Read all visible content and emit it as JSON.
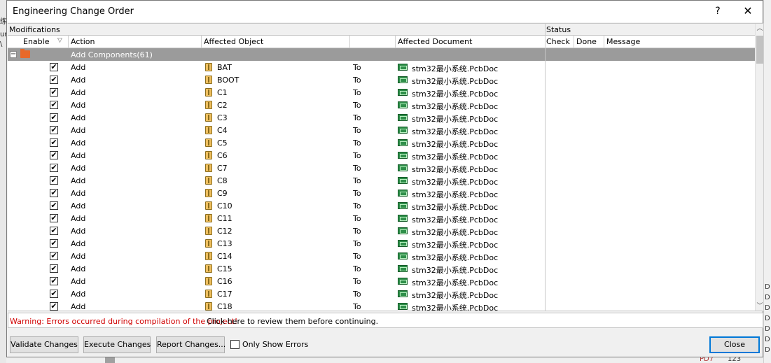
{
  "dialog": {
    "title": "Engineering Change Order",
    "help_label": "?",
    "close_label": "✕"
  },
  "grid": {
    "group_headers": {
      "modifications": "Modifications",
      "status": "Status"
    },
    "columns": {
      "enable": "Enable",
      "action": "Action",
      "affected_object": "Affected Object",
      "affected_document": "Affected Document",
      "check": "Check",
      "done": "Done",
      "message": "Message"
    },
    "group_row": {
      "expander": "−",
      "label": "Add Components(61)"
    },
    "rows": [
      {
        "enabled": "✔",
        "action": "Add",
        "object": "BAT",
        "to": "To",
        "document": "stm32最小系统.PcbDoc"
      },
      {
        "enabled": "✔",
        "action": "Add",
        "object": "BOOT",
        "to": "To",
        "document": "stm32最小系统.PcbDoc"
      },
      {
        "enabled": "✔",
        "action": "Add",
        "object": "C1",
        "to": "To",
        "document": "stm32最小系统.PcbDoc"
      },
      {
        "enabled": "✔",
        "action": "Add",
        "object": "C2",
        "to": "To",
        "document": "stm32最小系统.PcbDoc"
      },
      {
        "enabled": "✔",
        "action": "Add",
        "object": "C3",
        "to": "To",
        "document": "stm32最小系统.PcbDoc"
      },
      {
        "enabled": "✔",
        "action": "Add",
        "object": "C4",
        "to": "To",
        "document": "stm32最小系统.PcbDoc"
      },
      {
        "enabled": "✔",
        "action": "Add",
        "object": "C5",
        "to": "To",
        "document": "stm32最小系统.PcbDoc"
      },
      {
        "enabled": "✔",
        "action": "Add",
        "object": "C6",
        "to": "To",
        "document": "stm32最小系统.PcbDoc"
      },
      {
        "enabled": "✔",
        "action": "Add",
        "object": "C7",
        "to": "To",
        "document": "stm32最小系统.PcbDoc"
      },
      {
        "enabled": "✔",
        "action": "Add",
        "object": "C8",
        "to": "To",
        "document": "stm32最小系统.PcbDoc"
      },
      {
        "enabled": "✔",
        "action": "Add",
        "object": "C9",
        "to": "To",
        "document": "stm32最小系统.PcbDoc"
      },
      {
        "enabled": "✔",
        "action": "Add",
        "object": "C10",
        "to": "To",
        "document": "stm32最小系统.PcbDoc"
      },
      {
        "enabled": "✔",
        "action": "Add",
        "object": "C11",
        "to": "To",
        "document": "stm32最小系统.PcbDoc"
      },
      {
        "enabled": "✔",
        "action": "Add",
        "object": "C12",
        "to": "To",
        "document": "stm32最小系统.PcbDoc"
      },
      {
        "enabled": "✔",
        "action": "Add",
        "object": "C13",
        "to": "To",
        "document": "stm32最小系统.PcbDoc"
      },
      {
        "enabled": "✔",
        "action": "Add",
        "object": "C14",
        "to": "To",
        "document": "stm32最小系统.PcbDoc"
      },
      {
        "enabled": "✔",
        "action": "Add",
        "object": "C15",
        "to": "To",
        "document": "stm32最小系统.PcbDoc"
      },
      {
        "enabled": "✔",
        "action": "Add",
        "object": "C16",
        "to": "To",
        "document": "stm32最小系统.PcbDoc"
      },
      {
        "enabled": "✔",
        "action": "Add",
        "object": "C17",
        "to": "To",
        "document": "stm32最小系统.PcbDoc"
      },
      {
        "enabled": "✔",
        "action": "Add",
        "object": "C18",
        "to": "To",
        "document": "stm32最小系统.PcbDoc"
      }
    ]
  },
  "warning": {
    "text": "Warning: Errors occurred during compilation of the project!",
    "link": "Click here to review them before continuing.",
    "color": "#d00000"
  },
  "buttons": {
    "validate": "Validate Changes",
    "execute": "Execute Changes",
    "report": "Report Changes...",
    "only_show_errors": "Only Show Errors",
    "close": "Close"
  },
  "background": {
    "bottom_ref": "PD7",
    "bottom_num": "123"
  }
}
